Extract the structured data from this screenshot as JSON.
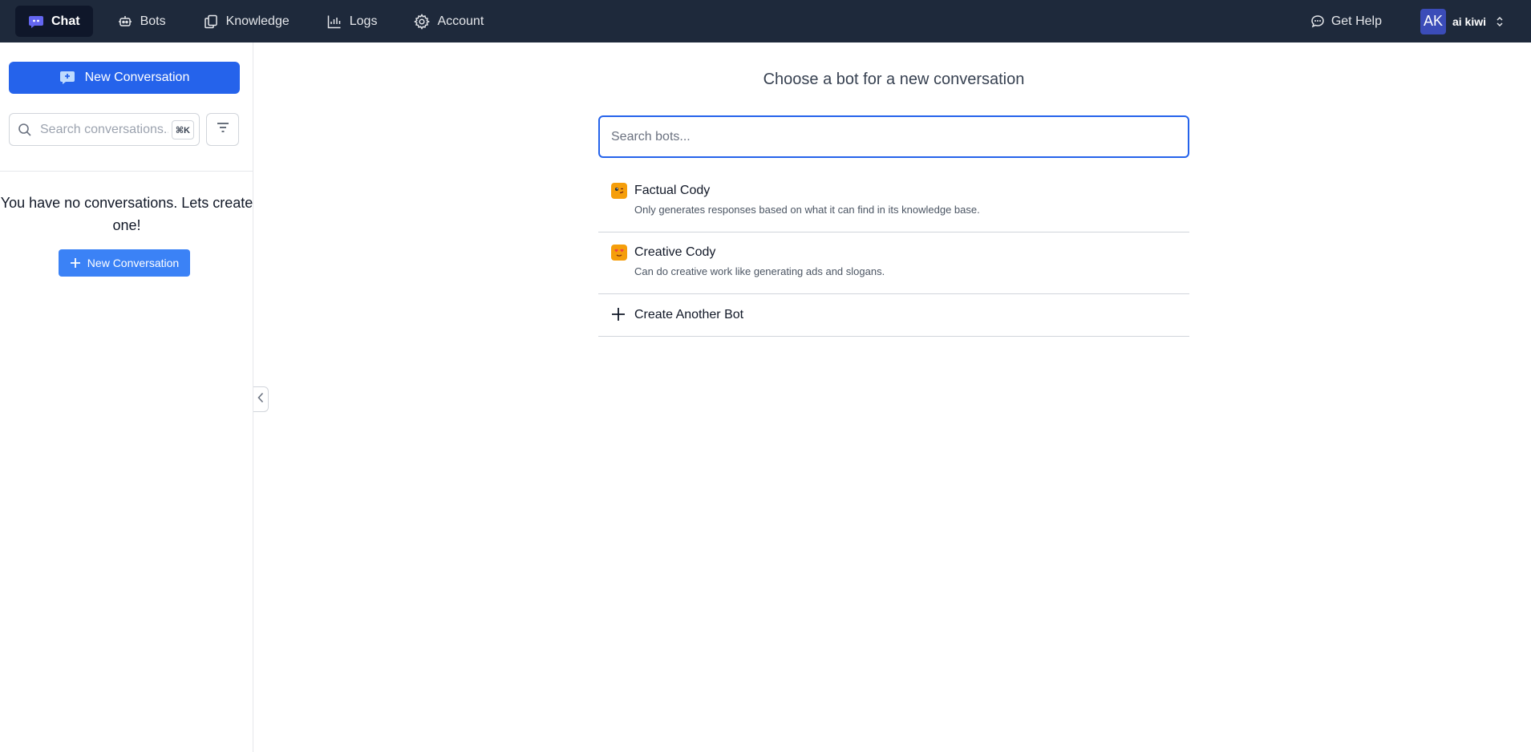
{
  "nav": {
    "items": [
      {
        "label": "Chat",
        "icon": "chat-bubble-icon",
        "active": true
      },
      {
        "label": "Bots",
        "icon": "robot-icon",
        "active": false
      },
      {
        "label": "Knowledge",
        "icon": "documents-icon",
        "active": false
      },
      {
        "label": "Logs",
        "icon": "chart-icon",
        "active": false
      },
      {
        "label": "Account",
        "icon": "gear-icon",
        "active": false
      }
    ],
    "help_label": "Get Help",
    "user": {
      "initials": "AK",
      "name": "ai kiwi"
    }
  },
  "sidebar": {
    "new_conversation_label": "New Conversation",
    "search_placeholder": "Search conversations...",
    "search_shortcut": "⌘K",
    "empty_message": "You have no conversations. Lets create one!",
    "empty_button_label": "New Conversation"
  },
  "main": {
    "title": "Choose a bot for a new conversation",
    "bot_search_placeholder": "Search bots...",
    "bots": [
      {
        "name": "Factual Cody",
        "description": "Only generates responses based on what it can find in its knowledge base.",
        "icon": "smirk-face-icon"
      },
      {
        "name": "Creative Cody",
        "description": "Can do creative work like generating ads and slogans.",
        "icon": "heart-eyes-face-icon"
      }
    ],
    "create_bot_label": "Create Another Bot"
  },
  "colors": {
    "topbar": "#1e293b",
    "primary": "#2563eb",
    "secondary_button": "#3b82f6",
    "avatar": "#3b4cb8"
  }
}
